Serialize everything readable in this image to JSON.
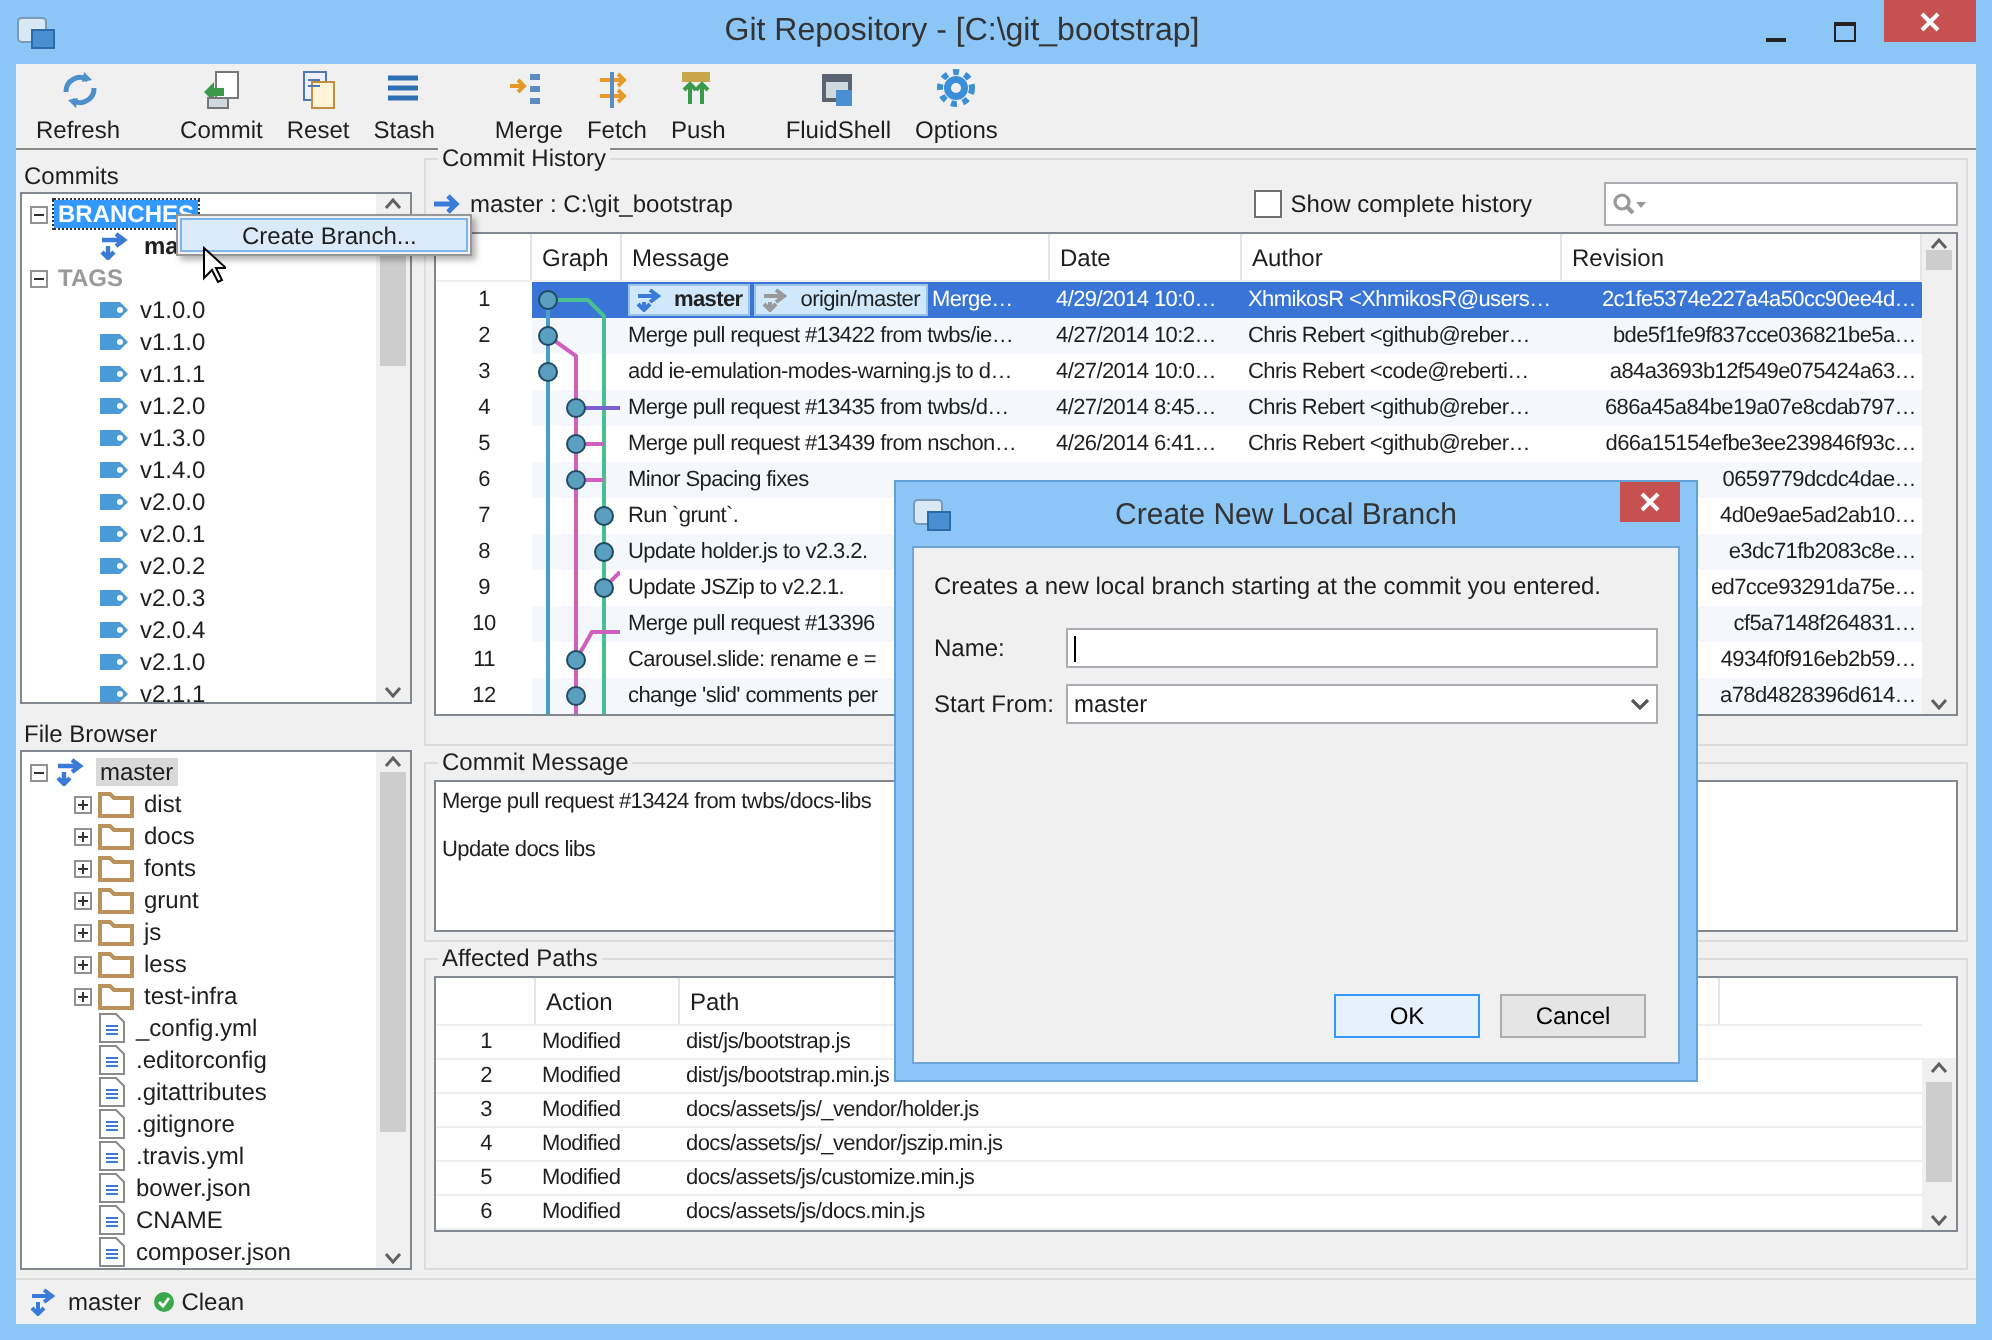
{
  "window": {
    "title": "Git Repository - [C:\\git_bootstrap]"
  },
  "toolbar": {
    "groups": [
      [
        {
          "label": "Refresh"
        }
      ],
      [
        {
          "label": "Commit"
        },
        {
          "label": "Reset"
        },
        {
          "label": "Stash"
        }
      ],
      [
        {
          "label": "Merge"
        },
        {
          "label": "Fetch"
        },
        {
          "label": "Push"
        }
      ],
      [
        {
          "label": "FluidShell"
        },
        {
          "label": "Options"
        }
      ]
    ]
  },
  "commits_panel": {
    "title": "Commits",
    "tree": [
      {
        "label": "BRANCHES",
        "kind": "group",
        "expanded": true,
        "selected": true,
        "children": [
          {
            "label": "ma",
            "kind": "branch",
            "selected": false
          }
        ]
      },
      {
        "label": "TAGS",
        "kind": "group",
        "expanded": true,
        "selected": false,
        "children": [
          {
            "label": "v1.0.0",
            "kind": "tag",
            "selected": false
          },
          {
            "label": "v1.1.0",
            "kind": "tag",
            "selected": false
          },
          {
            "label": "v1.1.1",
            "kind": "tag",
            "selected": false
          },
          {
            "label": "v1.2.0",
            "kind": "tag",
            "selected": false
          },
          {
            "label": "v1.3.0",
            "kind": "tag",
            "selected": false
          },
          {
            "label": "v1.4.0",
            "kind": "tag",
            "selected": false
          },
          {
            "label": "v2.0.0",
            "kind": "tag",
            "selected": false
          },
          {
            "label": "v2.0.1",
            "kind": "tag",
            "selected": false
          },
          {
            "label": "v2.0.2",
            "kind": "tag",
            "selected": false
          },
          {
            "label": "v2.0.3",
            "kind": "tag",
            "selected": false
          },
          {
            "label": "v2.0.4",
            "kind": "tag",
            "selected": false
          },
          {
            "label": "v2.1.0",
            "kind": "tag",
            "selected": false
          },
          {
            "label": "v2.1.1",
            "kind": "tag",
            "selected": false
          }
        ]
      }
    ]
  },
  "context_menu": {
    "items": [
      {
        "label": "Create Branch..."
      }
    ]
  },
  "file_browser": {
    "title": "File Browser",
    "tree": [
      {
        "label": "master",
        "kind": "branch",
        "expanded": true,
        "selected": true,
        "children": [
          {
            "label": "dist",
            "kind": "folder",
            "expanded": false,
            "selected": false
          },
          {
            "label": "docs",
            "kind": "folder",
            "expanded": false,
            "selected": false
          },
          {
            "label": "fonts",
            "kind": "folder",
            "expanded": false,
            "selected": false
          },
          {
            "label": "grunt",
            "kind": "folder",
            "expanded": false,
            "selected": false
          },
          {
            "label": "js",
            "kind": "folder",
            "expanded": false,
            "selected": false
          },
          {
            "label": "less",
            "kind": "folder",
            "expanded": false,
            "selected": false
          },
          {
            "label": "test-infra",
            "kind": "folder",
            "expanded": false,
            "selected": false
          },
          {
            "label": "_config.yml",
            "kind": "file",
            "selected": false
          },
          {
            "label": ".editorconfig",
            "kind": "file",
            "selected": false
          },
          {
            "label": ".gitattributes",
            "kind": "file",
            "selected": false
          },
          {
            "label": ".gitignore",
            "kind": "file",
            "selected": false
          },
          {
            "label": ".travis.yml",
            "kind": "file",
            "selected": false
          },
          {
            "label": "bower.json",
            "kind": "file",
            "selected": false
          },
          {
            "label": "CNAME",
            "kind": "file",
            "selected": false
          },
          {
            "label": "composer.json",
            "kind": "file",
            "selected": false
          }
        ]
      }
    ]
  },
  "commit_history": {
    "title": "Commit History",
    "path": "master : C:\\git_bootstrap",
    "show_complete_history": {
      "label": "Show complete history",
      "checked": false
    },
    "columns": [
      "Graph",
      "Message",
      "Date",
      "Author",
      "Revision"
    ],
    "rows": [
      {
        "number": "1",
        "selected": true,
        "refs": [
          {
            "label": "master",
            "kind": "local"
          },
          {
            "label": "origin/master",
            "kind": "remote"
          }
        ],
        "message": "Merge…",
        "date": "4/29/2014 10:0…",
        "author": "XhmikosR <XhmikosR@users…",
        "revision": "2c1fe5374e227a4a50cc90ee4d…"
      },
      {
        "number": "2",
        "selected": false,
        "message": "Merge pull request #13422 from twbs/ie…",
        "date": "4/27/2014 10:2…",
        "author": "Chris Rebert <github@reber…",
        "revision": "bde5f1fe9f837cce036821be5a…"
      },
      {
        "number": "3",
        "selected": false,
        "message": "add ie-emulation-modes-warning.js to d…",
        "date": "4/27/2014 10:0…",
        "author": "Chris Rebert <code@reberti…",
        "revision": "a84a3693b12f549e075424a63…"
      },
      {
        "number": "4",
        "selected": false,
        "message": "Merge pull request #13435 from twbs/d…",
        "date": "4/27/2014 8:45…",
        "author": "Chris Rebert <github@reber…",
        "revision": "686a45a84be19a07e8cdab797…"
      },
      {
        "number": "5",
        "selected": false,
        "message": "Merge pull request #13439 from nschon…",
        "date": "4/26/2014 6:41…",
        "author": "Chris Rebert <github@reber…",
        "revision": "d66a15154efbe3ee239846f93c…"
      },
      {
        "number": "6",
        "selected": false,
        "message": "Minor Spacing fixes",
        "revision": "0659779dcdc4dae…"
      },
      {
        "number": "7",
        "selected": false,
        "message": "Run `grunt`.",
        "revision": "4d0e9ae5ad2ab10…"
      },
      {
        "number": "8",
        "selected": false,
        "message": "Update holder.js to v2.3.2.",
        "revision": "e3dc71fb2083c8e…"
      },
      {
        "number": "9",
        "selected": false,
        "message": "Update JSZip to v2.2.1.",
        "revision": "ed7cce93291da75e…"
      },
      {
        "number": "10",
        "selected": false,
        "message": "Merge pull request #13396",
        "revision": "cf5a7148f264831…"
      },
      {
        "number": "11",
        "selected": false,
        "message": "Carousel.slide: rename e =",
        "revision": "4934f0f916eb2b59…"
      },
      {
        "number": "12",
        "selected": false,
        "message": "change 'slid' comments per",
        "revision": "a78d4828396d614…"
      }
    ]
  },
  "commit_message": {
    "title": "Commit Message",
    "paragraphs": [
      "Merge pull request #13424 from twbs/docs-libs",
      "Update docs libs"
    ]
  },
  "affected_paths": {
    "title": "Affected Paths",
    "columns": [
      "Action",
      "Path"
    ],
    "rows": [
      {
        "number": "1",
        "action": "Modified",
        "path": "dist/js/bootstrap.js"
      },
      {
        "number": "2",
        "action": "Modified",
        "path": "dist/js/bootstrap.min.js"
      },
      {
        "number": "3",
        "action": "Modified",
        "path": "docs/assets/js/_vendor/holder.js"
      },
      {
        "number": "4",
        "action": "Modified",
        "path": "docs/assets/js/_vendor/jszip.min.js"
      },
      {
        "number": "5",
        "action": "Modified",
        "path": "docs/assets/js/customize.min.js"
      },
      {
        "number": "6",
        "action": "Modified",
        "path": "docs/assets/js/docs.min.js"
      }
    ]
  },
  "status_bar": {
    "branch": "master",
    "state": "Clean"
  },
  "dialog": {
    "title": "Create New Local Branch",
    "description": "Creates a new local branch starting at the commit you entered.",
    "fields": [
      {
        "label": "Name:",
        "kind": "text",
        "focused": true
      },
      {
        "label": "Start From:",
        "kind": "select",
        "value": "master"
      }
    ],
    "buttons": [
      {
        "label": "OK",
        "default": true
      },
      {
        "label": "Cancel",
        "default": false
      }
    ]
  }
}
